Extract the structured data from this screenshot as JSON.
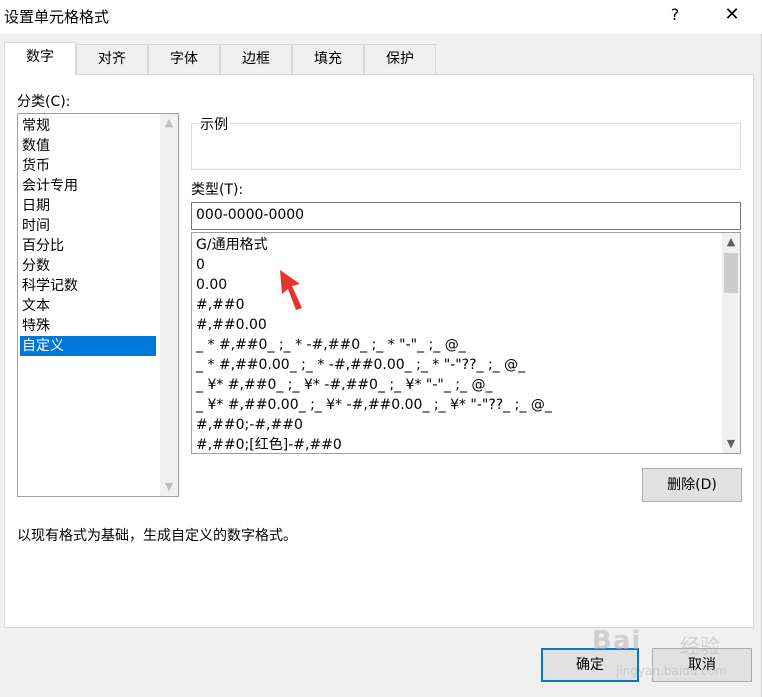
{
  "window": {
    "title": "设置单元格格式",
    "help": "?",
    "close": "✕"
  },
  "tabs": [
    {
      "label": "数字"
    },
    {
      "label": "对齐"
    },
    {
      "label": "字体"
    },
    {
      "label": "边框"
    },
    {
      "label": "填充"
    },
    {
      "label": "保护"
    }
  ],
  "category": {
    "label": "分类(C):",
    "items": [
      "常规",
      "数值",
      "货币",
      "会计专用",
      "日期",
      "时间",
      "百分比",
      "分数",
      "科学记数",
      "文本",
      "特殊",
      "自定义"
    ],
    "selected": "自定义"
  },
  "sample": {
    "legend": "示例",
    "value": ""
  },
  "type": {
    "label": "类型(T):",
    "input_value": "000-0000-0000",
    "formats": [
      "G/通用格式",
      "0",
      "0.00",
      "#,##0",
      "#,##0.00",
      "_ * #,##0_ ;_ * -#,##0_ ;_ * \"-\"_ ;_ @_",
      "_ * #,##0.00_ ;_ * -#,##0.00_ ;_ * \"-\"??_ ;_ @_",
      "_ ¥* #,##0_ ;_ ¥* -#,##0_ ;_ ¥* \"-\"_ ;_ @_",
      "_ ¥* #,##0.00_ ;_ ¥* -#,##0.00_ ;_ ¥* \"-\"??_ ;_ @_",
      "#,##0;-#,##0",
      "#,##0;[红色]-#,##0"
    ]
  },
  "delete_button": "删除(D)",
  "description": "以现有格式为基础，生成自定义的数字格式。",
  "ok_button": "确定",
  "cancel_button": "取消",
  "watermark": {
    "brand": "Bai",
    "brand2": "经验",
    "url": "jingyan.baidu.com"
  },
  "colors": {
    "accent": "#0078d7",
    "arrow": "#e8342a"
  }
}
